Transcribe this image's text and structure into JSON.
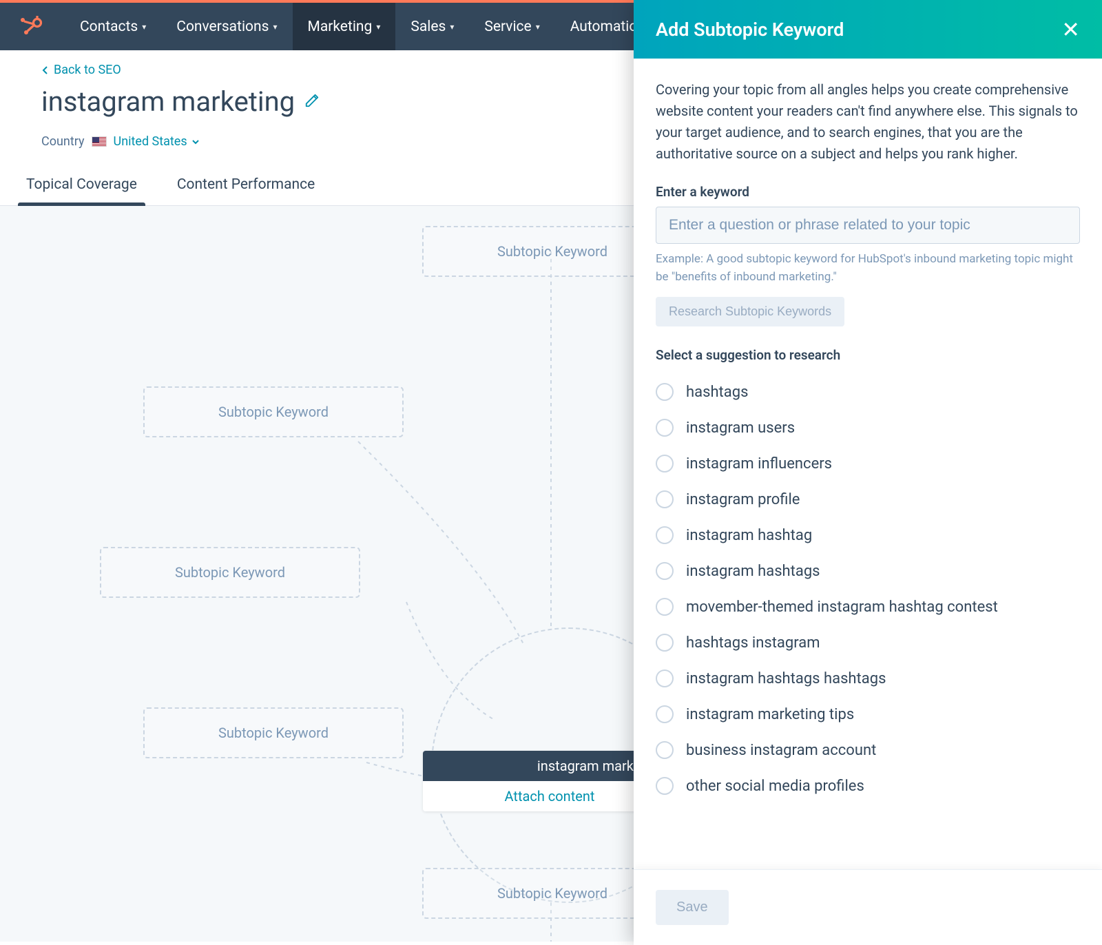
{
  "nav": {
    "items": [
      "Contacts",
      "Conversations",
      "Marketing",
      "Sales",
      "Service",
      "Automation"
    ],
    "active_index": 2
  },
  "header": {
    "back_label": "Back to SEO",
    "title": "instagram marketing",
    "country_label": "Country",
    "country_value": "United States"
  },
  "tabs": {
    "items": [
      "Topical Coverage",
      "Content Performance"
    ],
    "active_index": 0
  },
  "canvas": {
    "subtopic_placeholder": "Subtopic Keyword",
    "center_topic": "instagram marketing",
    "attach_label": "Attach content"
  },
  "panel": {
    "title": "Add Subtopic Keyword",
    "description": "Covering your topic from all angles helps you create comprehensive website content your readers can't find anywhere else. This signals to your target audience, and to search engines, that you are the authoritative source on a subject and helps you rank higher.",
    "input_label": "Enter a keyword",
    "input_placeholder": "Enter a question or phrase related to your topic",
    "example_text": "Example: A good subtopic keyword for HubSpot's inbound marketing topic might be \"benefits of inbound marketing.\"",
    "research_button": "Research Subtopic Keywords",
    "select_heading": "Select a suggestion to research",
    "suggestions": [
      "hashtags",
      "instagram users",
      "instagram influencers",
      "instagram profile",
      "instagram hashtag",
      "instagram hashtags",
      "movember-themed instagram hashtag contest",
      "hashtags instagram",
      "instagram hashtags hashtags",
      "instagram marketing tips",
      "business instagram account",
      "other social media profiles"
    ],
    "save_button": "Save"
  }
}
